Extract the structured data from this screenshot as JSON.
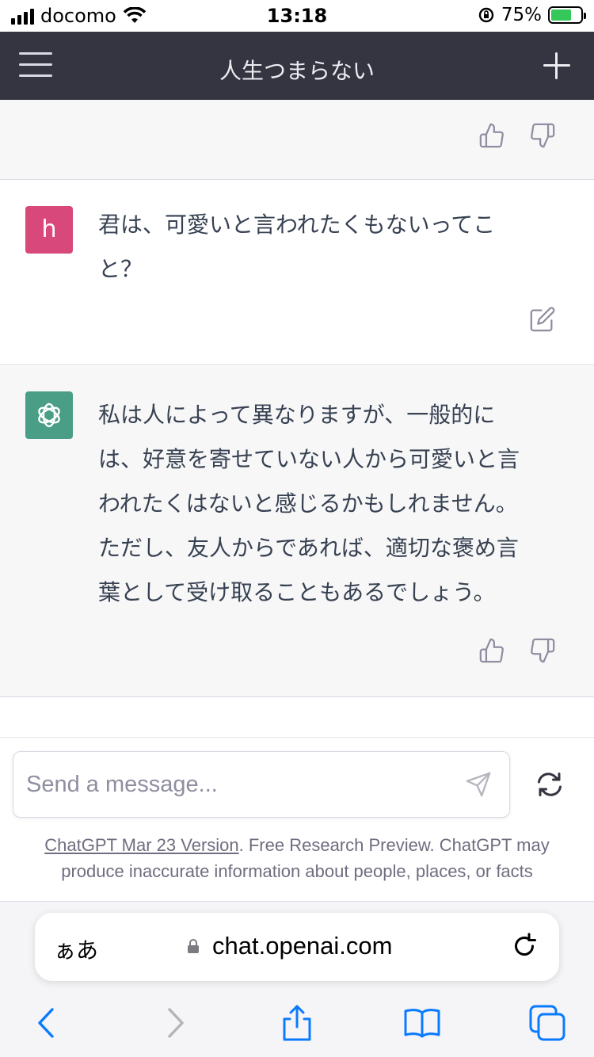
{
  "status_bar": {
    "carrier": "docomo",
    "time": "13:18",
    "battery_percent": "75%",
    "battery_level": 0.75,
    "icons": [
      "signal-icon",
      "wifi-icon",
      "orientation-lock-icon",
      "battery-charging-icon"
    ]
  },
  "header": {
    "title": "人生つまらない",
    "menu_icon": "hamburger-icon",
    "new_chat_icon": "plus-icon"
  },
  "messages": {
    "user": {
      "avatar_letter": "h",
      "text_lines": [
        "君は、可愛いと言われたくもないってこ",
        "と？"
      ]
    },
    "assistant": {
      "avatar_icon": "openai-logo-icon",
      "text_lines": [
        "私は人によって異なりますが、一般的に",
        "は、好意を寄せていない人から可愛いと言",
        "われたくはないと感じるかもしれません。",
        "ただし、友人からであれば、適切な褒め言",
        "葉として受け取ることもあるでしょう。"
      ]
    }
  },
  "composer": {
    "placeholder": "Send a message...",
    "send_icon": "send-icon",
    "regenerate_icon": "regenerate-icon"
  },
  "disclaimer": {
    "link": "ChatGPT Mar 23 Version",
    "text1": ". Free Research Preview. ChatGPT may",
    "text2": "produce inaccurate information about people, places, or facts"
  },
  "safari": {
    "aa_label": "ぁあ",
    "url": "chat.openai.com",
    "colors": {
      "toolbar_blue": "#0a7aff",
      "disabled": "#b4b4b8"
    }
  },
  "colors": {
    "header_bg": "#343541",
    "user_avatar": "#d9487a",
    "bot_avatar": "#4a9e85"
  }
}
